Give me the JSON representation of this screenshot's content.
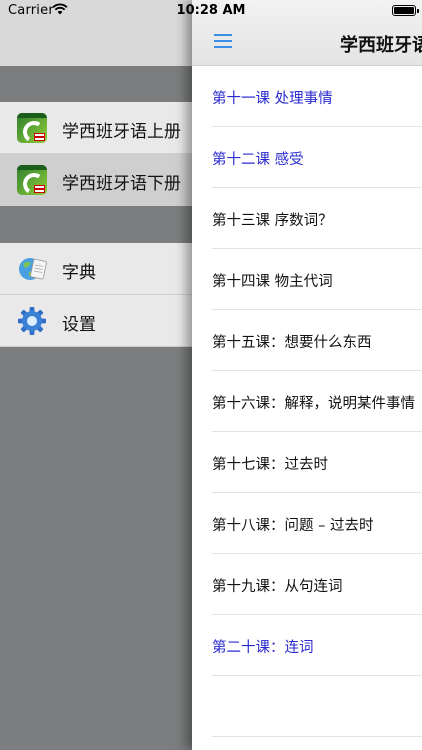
{
  "status_bar": {
    "carrier": "Carrier",
    "time": "10:28 AM"
  },
  "side_menu": {
    "books": [
      {
        "label": "学西班牙语上册",
        "icon": "book-cover-icon",
        "selected": false
      },
      {
        "label": "学西班牙语下册",
        "icon": "book-cover-icon",
        "selected": true
      }
    ],
    "tools": [
      {
        "label": "字典",
        "icon": "dictionary-icon"
      },
      {
        "label": "设置",
        "icon": "gear-icon"
      }
    ]
  },
  "nav_bar": {
    "title": "学西班牙语",
    "menu_icon": "hamburger-menu-icon"
  },
  "lessons": [
    {
      "label": "第十一课 处理事情",
      "state": "read"
    },
    {
      "label": "第十二课 感受",
      "state": "read"
    },
    {
      "label": "第十三课 序数词？",
      "state": "unread"
    },
    {
      "label": "第十四课 物主代词",
      "state": "unread"
    },
    {
      "label": "第十五课：想要什么东西",
      "state": "unread"
    },
    {
      "label": "第十六课：解释，说明某件事情",
      "state": "unread"
    },
    {
      "label": "第十七课：过去时",
      "state": "unread"
    },
    {
      "label": "第十八课：问题 – 过去时",
      "state": "unread"
    },
    {
      "label": "第十九课：从句连词",
      "state": "unread"
    },
    {
      "label": "第二十课：连词",
      "state": "read"
    }
  ],
  "colors": {
    "accent": "#3a8ee6",
    "read_link": "#2a2ad0",
    "menu_background": "#7b7d7e"
  }
}
